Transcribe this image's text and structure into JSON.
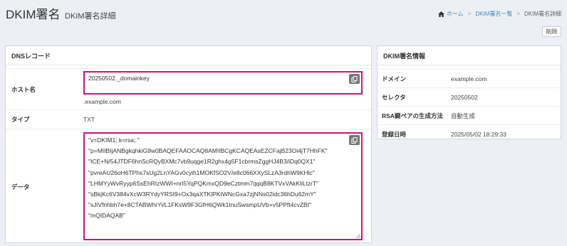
{
  "header": {
    "title": "DKIM署名",
    "subtitle": "DKIM署名詳細",
    "breadcrumb": [
      "ホーム",
      "DKIM署名一覧",
      "DKIM署名詳細"
    ],
    "delete_label": "削除"
  },
  "dns": {
    "title": "DNSレコード",
    "host_label": "ホスト名",
    "host_value": "20250502._domainkey",
    "host_suffix": ".example.com",
    "type_label": "タイプ",
    "type_value": "TXT",
    "data_label": "データ",
    "data_lines": [
      "\"v=DKIM1; k=rsa; \"",
      "\"p=MIIBIjANBgkqhkiG9w0BAQEFAAOCAQ8AMIIBCgKCAQEAsEZCFajB23Oi4jT7HhFK\"",
      "\"ICE+N/54JTDF6hnScRQyBXMc7vb9uqge1R2ghx4g5F1cbrmsZggHJ4B3/iDq0QX1\"",
      "\"pvreAU26oH6TPhs7sUg2LnYAGv0cyih1MOKfSO2V/e8c066XXySLzA3rdhW9KHlc\"",
      "\"LHMYyWvRyyp6SsEhRIzWWI+nrI5YqPQKmxQD9eCztmm7qqqB8KTVxVAkKliLtzrT\"",
      "\"sBkjKc6V384vXcW3RYdyYRSI9+Ox3qaXTKlPKtWNcGxa7zjNNs02idc36hDu62mY\"",
      "\"sJiVfnhbh7e+8CTABWhrYi/L1FKsW9F3GfH6QWk1InuSwsmpUVb+v5PPft4cvZBt\"",
      "\"mQIDAQAB\""
    ]
  },
  "info": {
    "title": "DKIM署名情報",
    "rows": [
      {
        "label": "ドメイン",
        "value": "example.com"
      },
      {
        "label": "セレクタ",
        "value": "20250502"
      },
      {
        "label": "RSA鍵ペアの生成方法",
        "value": "自動生成"
      },
      {
        "label": "登録日時",
        "value": "2025/05/02 18:29:33"
      }
    ]
  }
}
